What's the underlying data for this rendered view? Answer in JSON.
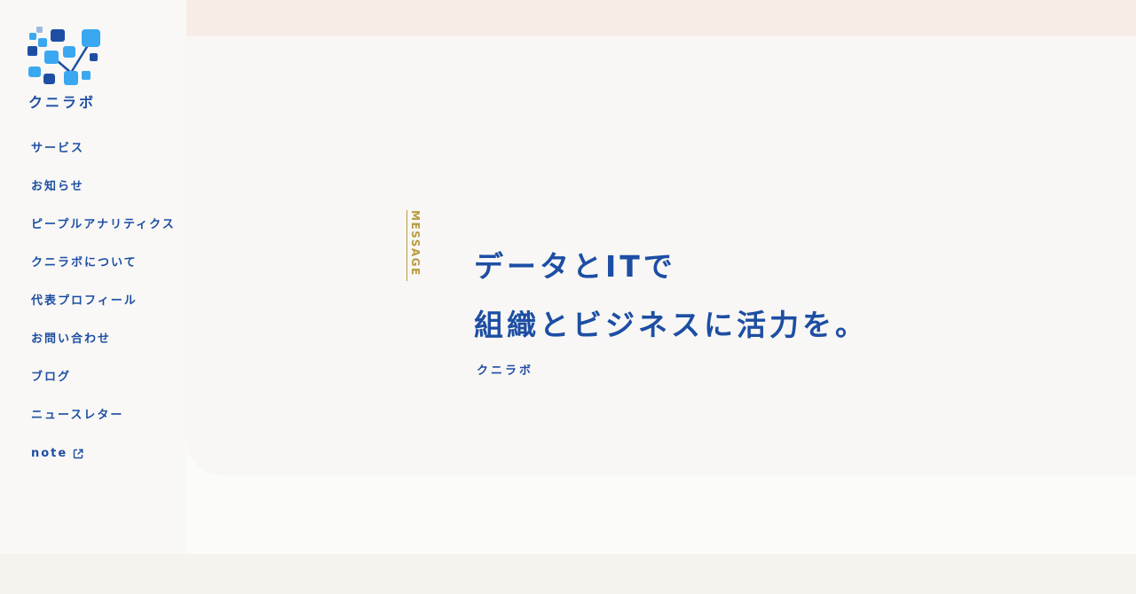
{
  "brand": {
    "name": "クニラボ"
  },
  "nav": {
    "items": [
      {
        "label": "サービス"
      },
      {
        "label": "お知らせ"
      },
      {
        "label": "ピープルアナリティクス"
      },
      {
        "label": "クニラボについて"
      },
      {
        "label": "代表プロフィール"
      },
      {
        "label": "お問い合わせ"
      },
      {
        "label": "ブログ"
      },
      {
        "label": "ニュースレター"
      },
      {
        "label": "note",
        "icon": "external-link-icon"
      }
    ]
  },
  "message": {
    "section_label": "MESSAGE",
    "headline_line1": "データとITで",
    "headline_line2": "組織とビジネスに活力を。",
    "signature": "クニラボ"
  },
  "colors": {
    "brand_blue": "#1d4ea3",
    "light_blue": "#3aa8f0",
    "accent_gold": "#b89a3e",
    "background": "#f6f2ee"
  }
}
